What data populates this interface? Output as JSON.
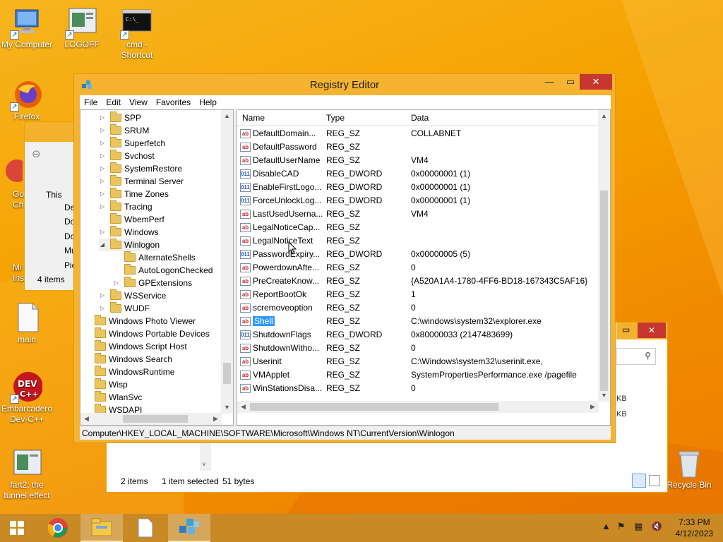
{
  "desktop": {
    "icons": [
      {
        "label": "My Computer",
        "icon": "computer-icon"
      },
      {
        "label": "LOGOFF",
        "icon": "document-icon"
      },
      {
        "label": "cmd - Shortcut",
        "icon": "cmd-icon"
      },
      {
        "label": "Firefox",
        "icon": "firefox-icon"
      },
      {
        "label": "main",
        "icon": "text-file-icon"
      },
      {
        "label": "Embarcadero Dev-C++",
        "icon": "devcpp-icon"
      },
      {
        "label": "fart2; the tunnel effect",
        "icon": "image-file-icon"
      },
      {
        "label": "Recycle Bin",
        "icon": "recycle-bin-icon"
      }
    ],
    "partial_labels": [
      "Go",
      "Ch",
      "Mi",
      "Ins"
    ]
  },
  "explorer_back": {
    "nav_items": [
      "This",
      "De",
      "Do",
      "Do",
      "Mu",
      "Pic"
    ],
    "item_count": "4 items"
  },
  "explorer_front": {
    "status_items": "2 items",
    "status_selected": "1 item selected",
    "status_size": "51 bytes",
    "size_cells": [
      "KB",
      "KB"
    ]
  },
  "regedit": {
    "title": "Registry Editor",
    "menu": [
      "File",
      "Edit",
      "View",
      "Favorites",
      "Help"
    ],
    "columns": {
      "name": "Name",
      "type": "Type",
      "data": "Data"
    },
    "tree": [
      {
        "label": "SPP",
        "level": 1,
        "expander": "closed"
      },
      {
        "label": "SRUM",
        "level": 1,
        "expander": "closed"
      },
      {
        "label": "Superfetch",
        "level": 1,
        "expander": "closed"
      },
      {
        "label": "Svchost",
        "level": 1,
        "expander": "closed"
      },
      {
        "label": "SystemRestore",
        "level": 1,
        "expander": "closed"
      },
      {
        "label": "Terminal Server",
        "level": 1,
        "expander": "closed"
      },
      {
        "label": "Time Zones",
        "level": 1,
        "expander": "closed"
      },
      {
        "label": "Tracing",
        "level": 1,
        "expander": "closed"
      },
      {
        "label": "WbemPerf",
        "level": 1,
        "expander": "none"
      },
      {
        "label": "Windows",
        "level": 1,
        "expander": "closed"
      },
      {
        "label": "Winlogon",
        "level": 1,
        "expander": "open"
      },
      {
        "label": "AlternateShells",
        "level": 2,
        "expander": "none"
      },
      {
        "label": "AutoLogonChecked",
        "level": 2,
        "expander": "none"
      },
      {
        "label": "GPExtensions",
        "level": 2,
        "expander": "closed"
      },
      {
        "label": "WSService",
        "level": 1,
        "expander": "closed"
      },
      {
        "label": "WUDF",
        "level": 1,
        "expander": "closed"
      },
      {
        "label": "Windows Photo Viewer",
        "level": 0,
        "expander": "none"
      },
      {
        "label": "Windows Portable Devices",
        "level": 0,
        "expander": "none"
      },
      {
        "label": "Windows Script Host",
        "level": 0,
        "expander": "none"
      },
      {
        "label": "Windows Search",
        "level": 0,
        "expander": "none"
      },
      {
        "label": "WindowsRuntime",
        "level": 0,
        "expander": "none"
      },
      {
        "label": "Wisp",
        "level": 0,
        "expander": "none"
      },
      {
        "label": "WlanSvc",
        "level": 0,
        "expander": "none"
      },
      {
        "label": "WSDAPI",
        "level": 0,
        "expander": "none"
      }
    ],
    "values": [
      {
        "name": "DefaultDomain...",
        "type": "REG_SZ",
        "data": "COLLABNET"
      },
      {
        "name": "DefaultPassword",
        "type": "REG_SZ",
        "data": ""
      },
      {
        "name": "DefaultUserName",
        "type": "REG_SZ",
        "data": "VM4"
      },
      {
        "name": "DisableCAD",
        "type": "REG_DWORD",
        "data": "0x00000001 (1)"
      },
      {
        "name": "EnableFirstLogo...",
        "type": "REG_DWORD",
        "data": "0x00000001 (1)"
      },
      {
        "name": "ForceUnlockLog...",
        "type": "REG_DWORD",
        "data": "0x00000001 (1)"
      },
      {
        "name": "LastUsedUserna...",
        "type": "REG_SZ",
        "data": "VM4"
      },
      {
        "name": "LegalNoticeCap...",
        "type": "REG_SZ",
        "data": ""
      },
      {
        "name": "LegalNoticeText",
        "type": "REG_SZ",
        "data": ""
      },
      {
        "name": "PasswordExpiry...",
        "type": "REG_DWORD",
        "data": "0x00000005 (5)"
      },
      {
        "name": "PowerdownAfte...",
        "type": "REG_SZ",
        "data": "0"
      },
      {
        "name": "PreCreateKnow...",
        "type": "REG_SZ",
        "data": "{A520A1A4-1780-4FF6-BD18-167343C5AF16}"
      },
      {
        "name": "ReportBootOk",
        "type": "REG_SZ",
        "data": "1"
      },
      {
        "name": "scremoveoption",
        "type": "REG_SZ",
        "data": "0"
      },
      {
        "name": "Shell",
        "type": "REG_SZ",
        "data": "C:\\windows\\system32\\explorer.exe"
      },
      {
        "name": "ShutdownFlags",
        "type": "REG_DWORD",
        "data": "0x80000033 (2147483699)"
      },
      {
        "name": "ShutdownWitho...",
        "type": "REG_SZ",
        "data": "0"
      },
      {
        "name": "Userinit",
        "type": "REG_SZ",
        "data": "C:\\Windows\\system32\\userinit.exe,"
      },
      {
        "name": "VMApplet",
        "type": "REG_SZ",
        "data": "SystemPropertiesPerformance.exe /pagefile"
      },
      {
        "name": "WinStationsDisa...",
        "type": "REG_SZ",
        "data": "0"
      }
    ],
    "selected_value": "Shell",
    "status_path": "Computer\\HKEY_LOCAL_MACHINE\\SOFTWARE\\Microsoft\\Windows NT\\CurrentVersion\\Winlogon"
  },
  "taskbar": {
    "pinned": [
      "start-icon",
      "chrome-icon",
      "file-explorer-icon",
      "notepad-icon",
      "regedit-icon"
    ],
    "tray_icons": [
      "show-hidden-icons-icon",
      "action-center-flag-icon",
      "network-icon",
      "volume-muted-icon"
    ],
    "time": "7:33 PM",
    "date": "4/12/2023"
  },
  "colors": {
    "accent": "#f5b32f",
    "selection": "#3399ff",
    "close_button": "#c7372f"
  }
}
